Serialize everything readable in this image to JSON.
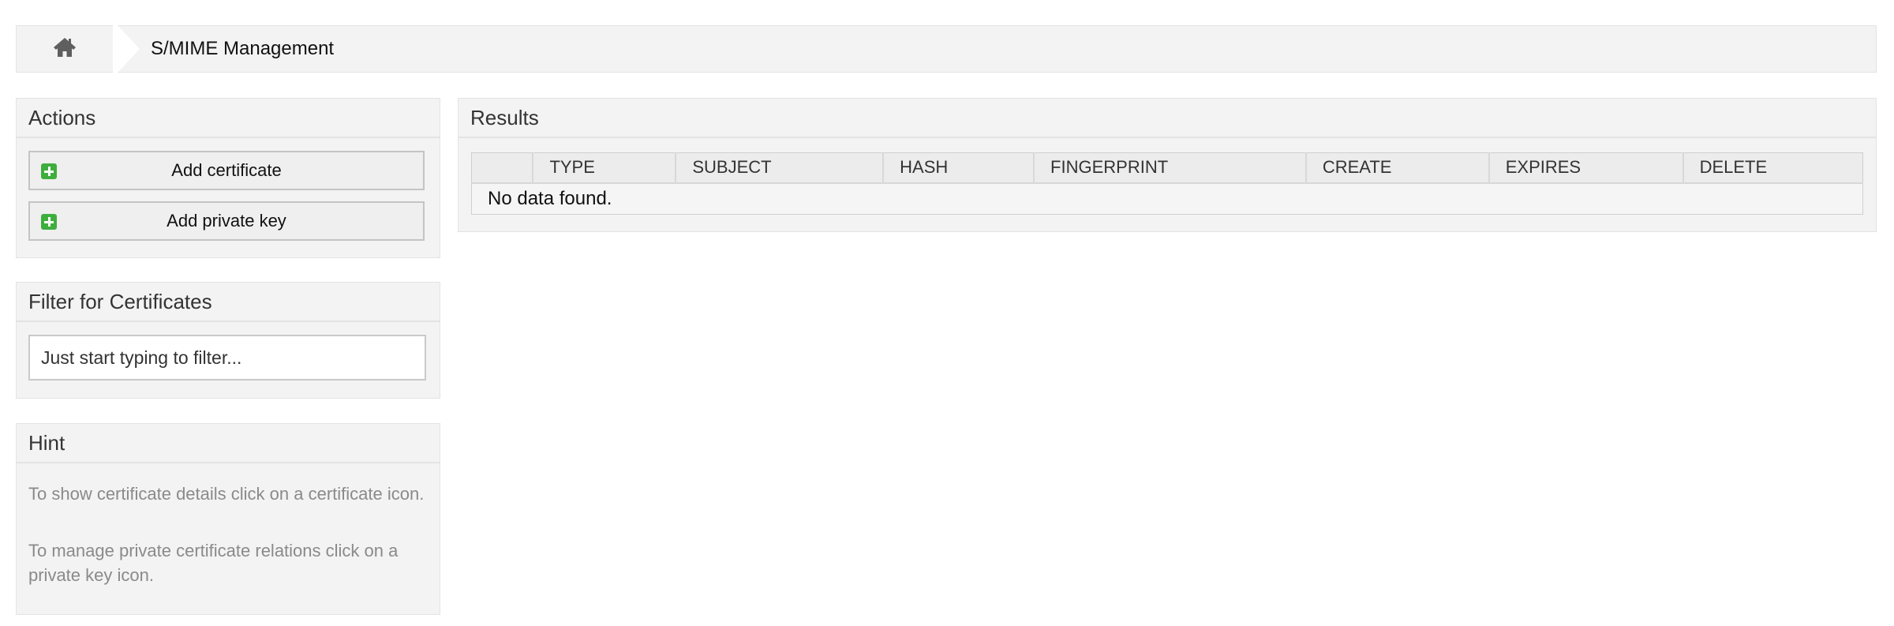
{
  "breadcrumb": {
    "home_icon": "home-icon",
    "title": "S/MIME Management"
  },
  "actions": {
    "title": "Actions",
    "add_certificate": "Add certificate",
    "add_private_key": "Add private key",
    "icon": "plus-icon",
    "accent_color": "#3eae3e"
  },
  "filter": {
    "title": "Filter for Certificates",
    "placeholder": "Just start typing to filter..."
  },
  "hint": {
    "title": "Hint",
    "line1": "To show certificate details click on a certificate icon.",
    "line2": "To manage private certificate relations click on a private key icon."
  },
  "results": {
    "title": "Results",
    "columns": [
      "",
      "TYPE",
      "SUBJECT",
      "HASH",
      "FINGERPRINT",
      "CREATE",
      "EXPIRES",
      "DELETE"
    ],
    "empty_message": "No data found."
  }
}
